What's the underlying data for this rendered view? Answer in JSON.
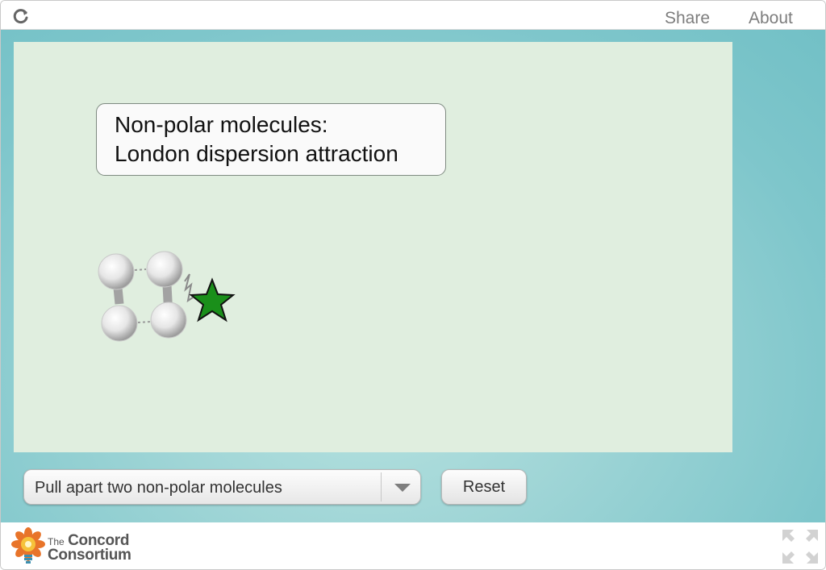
{
  "topbar": {
    "reload_icon": "reload-icon",
    "share_label": "Share",
    "about_label": "About"
  },
  "simulation": {
    "callout_line1": "Non-polar molecules:",
    "callout_line2": "London dispersion attraction",
    "background_color": "#e0eedf",
    "star_color": "#1a8f1a"
  },
  "controls": {
    "selected_option": "Pull apart two non-polar molecules",
    "reset_label": "Reset"
  },
  "footer": {
    "logo_the": "The",
    "logo_name": "Concord",
    "logo_line2": "Consortium",
    "fullscreen_icon": "fullscreen-icon"
  }
}
